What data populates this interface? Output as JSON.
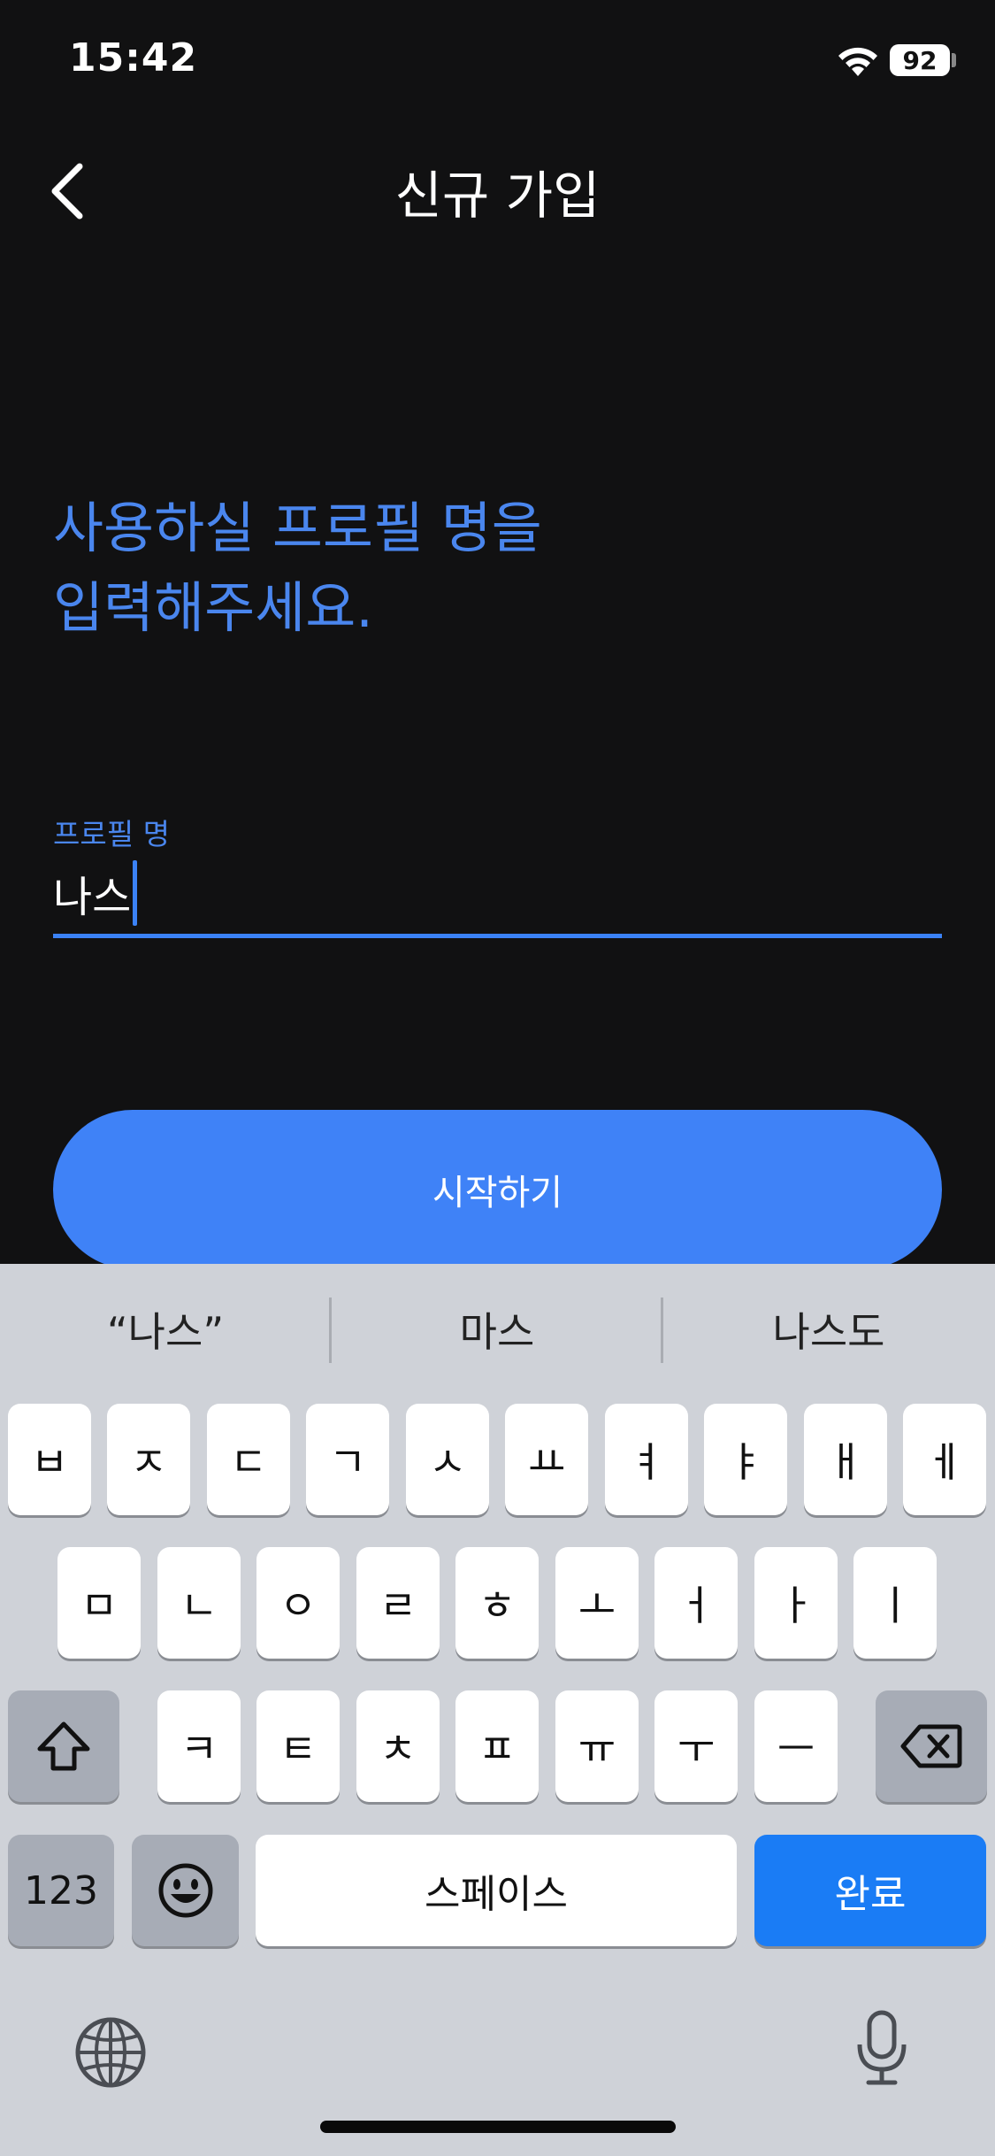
{
  "status": {
    "time": "15:42",
    "battery": "92"
  },
  "header": {
    "title": "신규 가입"
  },
  "headline": {
    "line1": "사용하실 프로필 명을",
    "line2": "입력해주세요."
  },
  "profile_field": {
    "label": "프로필 명",
    "value": "나스"
  },
  "start_button": {
    "label": "시작하기"
  },
  "keyboard": {
    "suggestions": [
      "“나스”",
      "마스",
      "나스도"
    ],
    "row1": [
      "ㅂ",
      "ㅈ",
      "ㄷ",
      "ㄱ",
      "ㅅ",
      "ㅛ",
      "ㅕ",
      "ㅑ",
      "ㅐ",
      "ㅔ"
    ],
    "row2": [
      "ㅁ",
      "ㄴ",
      "ㅇ",
      "ㄹ",
      "ㅎ",
      "ㅗ",
      "ㅓ",
      "ㅏ",
      "ㅣ"
    ],
    "row3": [
      "ㅋ",
      "ㅌ",
      "ㅊ",
      "ㅍ",
      "ㅠ",
      "ㅜ",
      "ㅡ"
    ],
    "numbers_label": "123",
    "space_label": "스페이스",
    "done_label": "완료"
  },
  "colors": {
    "accent": "#3f82f7",
    "headline": "#4a86ee",
    "background": "#111112",
    "keyboard_bg": "#cfd2d8"
  }
}
